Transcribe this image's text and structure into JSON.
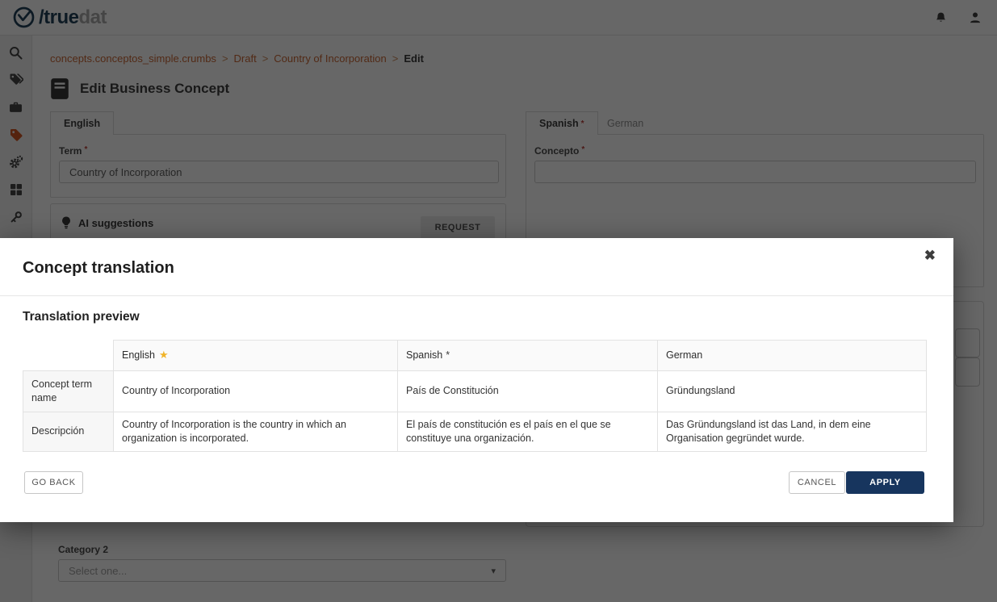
{
  "header": {
    "logo_primary": "/true",
    "logo_secondary": "dat"
  },
  "breadcrumb": {
    "separator": ">",
    "links": [
      "concepts.conceptos_simple.crumbs",
      "Draft",
      "Country of Incorporation"
    ],
    "current": "Edit"
  },
  "page": {
    "title": "Edit Business Concept"
  },
  "marks": {
    "required": "*"
  },
  "english_panel": {
    "tab_label": "English",
    "term_label": "Term",
    "term_value": "Country of Incorporation"
  },
  "translation_panel": {
    "spanish_tab_label": "Spanish",
    "german_tab_label": "German",
    "concepto_label": "Concepto",
    "concepto_value": ""
  },
  "ai_suggestions": {
    "title": "AI suggestions",
    "request_button": "REQUEST"
  },
  "category": {
    "label": "Category 2",
    "placeholder": "Select one..."
  },
  "modal": {
    "title": "Concept translation",
    "section_title": "Translation preview",
    "table": {
      "columns": [
        "English",
        "Spanish",
        "German"
      ],
      "row_headers": [
        "Concept term name",
        "Descripción"
      ],
      "rows": [
        [
          "Country of Incorporation",
          "País de Constitución",
          "Gründungsland"
        ],
        [
          "Country of Incorporation is the country in which an organization is incorporated.",
          "El país de constitución es el país en el que se constituye una organización.",
          "Das Gründungsland ist das Land, in dem eine Organisation gegründet wurde."
        ]
      ]
    },
    "buttons": {
      "go_back": "GO BACK",
      "cancel": "CANCEL",
      "apply": "APPLY"
    }
  },
  "icons": {
    "close": "✖",
    "star": "★",
    "caret": "▾"
  },
  "colors": {
    "accent_orange": "#cf4d17",
    "navy": "#17355e",
    "star_gold": "#f0b429",
    "required_red": "#b5342d",
    "breadcrumb_link": "#c75f2a",
    "overlay": "rgba(10,10,10,0.62)"
  }
}
